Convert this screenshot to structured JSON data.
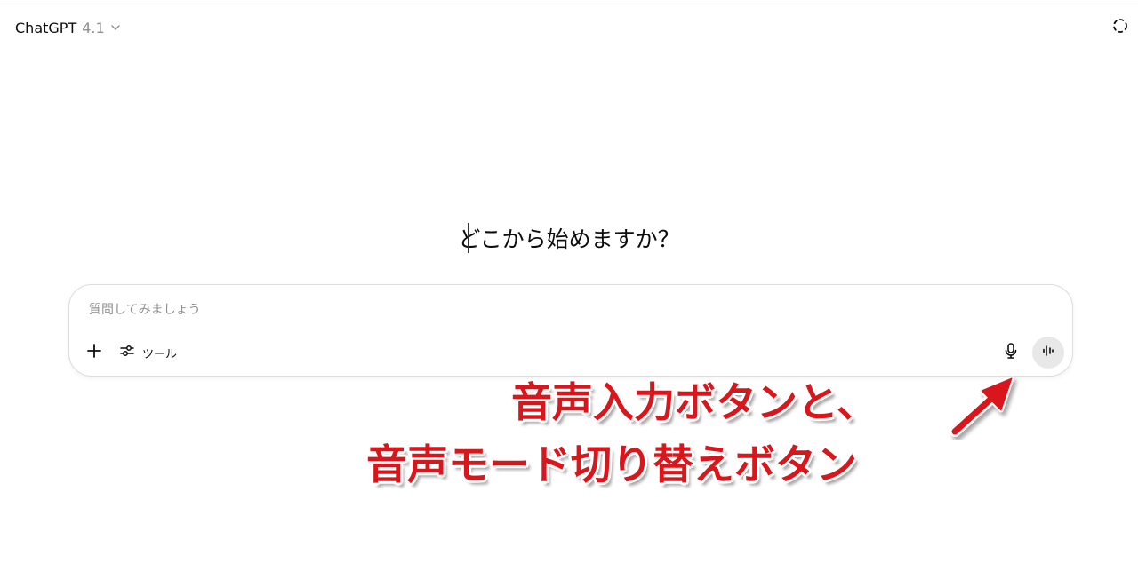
{
  "header": {
    "model_name": "ChatGPT",
    "model_version": "4.1",
    "model_chevron_icon": "chevron-down-icon",
    "temporary_chat_icon": "dashed-circle-icon"
  },
  "main": {
    "heading": "どこから始めますか？"
  },
  "composer": {
    "placeholder": "質問してみましょう",
    "add_icon": "plus-icon",
    "tools_icon": "sliders-icon",
    "tools_label": "ツール",
    "mic_icon": "microphone-icon",
    "voice_mode_icon": "waveform-icon"
  },
  "annotation": {
    "line1": "音声入力ボタンと、",
    "line2": "音声モード切り替えボタン",
    "color": "#d8161b",
    "arrow_icon": "red-arrow-icon"
  },
  "colors": {
    "voice_button_bg": "#e8e8e8",
    "composer_border": "#dcdcdc",
    "placeholder_text": "#8f8f8f"
  }
}
